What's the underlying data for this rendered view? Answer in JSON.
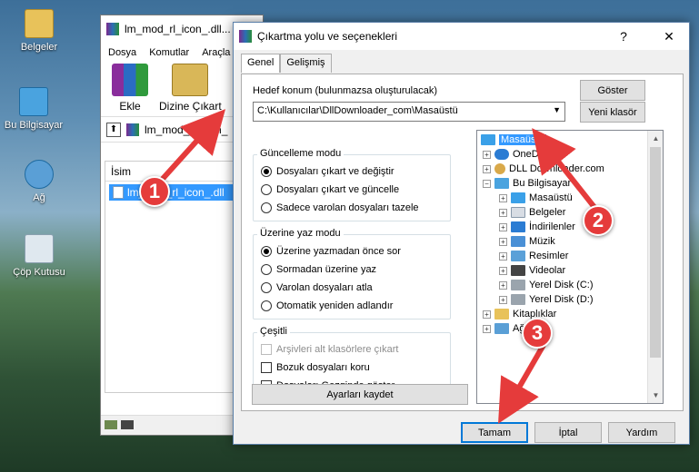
{
  "desktop": {
    "icons": [
      {
        "label": "Belgeler",
        "icon": "folder-icon"
      },
      {
        "label": "Bu Bilgisayar",
        "icon": "computer-icon"
      },
      {
        "label": "Ağ",
        "icon": "network-icon"
      },
      {
        "label": "Çöp Kutusu",
        "icon": "recycle-bin-icon"
      }
    ]
  },
  "bg_window": {
    "title": "lm_mod_rl_icon_.dll...",
    "menu": [
      "Dosya",
      "Komutlar",
      "Araçla"
    ],
    "toolbar": {
      "add_label": "Ekle",
      "extract_label": "Dizine Çıkart"
    },
    "path": "lm_mod_rl_icon_",
    "list_header": "İsim",
    "file_name": "lm_mod_rl_icon_.dll"
  },
  "dialog": {
    "title": "Çıkartma yolu ve seçenekleri",
    "help_symbol": "?",
    "close_symbol": "✕",
    "tabs": [
      "Genel",
      "Gelişmiş"
    ],
    "destination_label": "Hedef konum (bulunmazsa oluşturulacak)",
    "destination_value": "C:\\Kullanıcılar\\DllDownloader_com\\Masaüstü",
    "show_button": "Göster",
    "new_folder_button": "Yeni klasör",
    "update_mode": {
      "title": "Güncelleme modu",
      "options": [
        "Dosyaları çıkart ve değiştir",
        "Dosyaları çıkart ve güncelle",
        "Sadece varolan dosyaları tazele"
      ],
      "selected": 0
    },
    "overwrite_mode": {
      "title": "Üzerine yaz modu",
      "options": [
        "Üzerine yazmadan önce sor",
        "Sormadan üzerine yaz",
        "Varolan dosyaları atla",
        "Otomatik yeniden adlandır"
      ],
      "selected": 0
    },
    "misc": {
      "title": "Çeşitli",
      "options": [
        "Arşivleri alt klasörlere çıkart",
        "Bozuk dosyaları koru",
        "Dosyaları Gezginde göster"
      ]
    },
    "save_settings_button": "Ayarları kaydet",
    "tree": [
      {
        "label": "Masaüstü",
        "depth": 0,
        "selected": true,
        "icon": "desktop-icon"
      },
      {
        "label": "OneDrive",
        "depth": 1,
        "icon": "cloud-icon"
      },
      {
        "label": "DLL Downloader.com",
        "depth": 1,
        "icon": "user-icon"
      },
      {
        "label": "Bu Bilgisayar",
        "depth": 1,
        "icon": "computer-icon"
      },
      {
        "label": "Masaüstü",
        "depth": 2,
        "icon": "desktop-icon"
      },
      {
        "label": "Belgeler",
        "depth": 2,
        "icon": "documents-icon"
      },
      {
        "label": "İndirilenler",
        "depth": 2,
        "icon": "download-icon"
      },
      {
        "label": "Müzik",
        "depth": 2,
        "icon": "music-icon"
      },
      {
        "label": "Resimler",
        "depth": 2,
        "icon": "pictures-icon"
      },
      {
        "label": "Videolar",
        "depth": 2,
        "icon": "video-icon"
      },
      {
        "label": "Yerel Disk (C:)",
        "depth": 2,
        "icon": "drive-icon"
      },
      {
        "label": "Yerel Disk (D:)",
        "depth": 2,
        "icon": "drive-icon"
      },
      {
        "label": "Kitaplıklar",
        "depth": 1,
        "icon": "library-icon"
      },
      {
        "label": "Ağ",
        "depth": 1,
        "icon": "network-icon"
      }
    ],
    "ok_button": "Tamam",
    "cancel_button": "İptal",
    "help_button": "Yardım"
  },
  "annotations": [
    "1",
    "2",
    "3"
  ],
  "colors": {
    "accent": "#3399ff",
    "badge": "#e53b3b"
  }
}
